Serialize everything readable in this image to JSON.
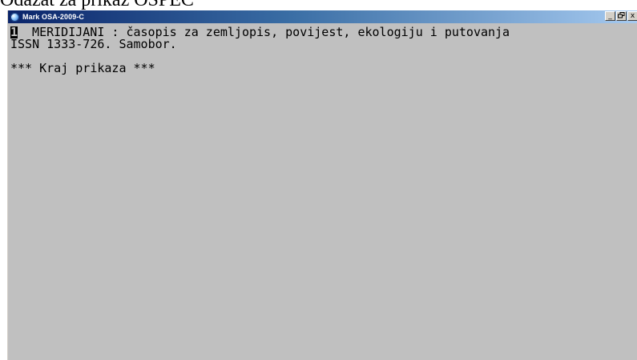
{
  "caption": {
    "text": "Odazat za prikaz OSPEC"
  },
  "window": {
    "title": "Mark OSA-2009-C",
    "controls": {
      "minimize": "_",
      "maximize": "3",
      "close": "x"
    }
  },
  "terminal": {
    "record_number": "1",
    "record_line_1": "  MERIDIJANI : časopis za zemljopis, povijest, ekologiju i putovanja",
    "record_line_2": "ISSN 1333-726. Samobor.",
    "end_message": "*** Kraj prikaza ***"
  },
  "colors": {
    "screen_background": "#c0c0c0",
    "text": "#000000",
    "titlebar_start": "#0a246a",
    "titlebar_end": "#a6caf0"
  }
}
